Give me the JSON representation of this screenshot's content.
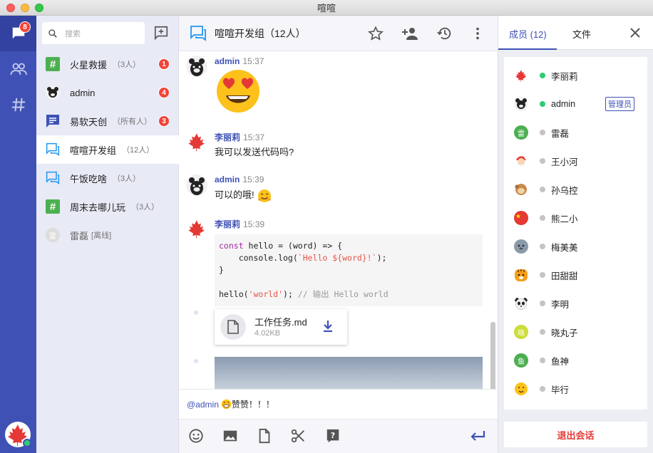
{
  "window": {
    "title": "喧喧"
  },
  "nav": {
    "chat_badge": "8"
  },
  "search": {
    "placeholder": "搜索"
  },
  "conversations": [
    {
      "name": "火星救援",
      "count": "（3人）",
      "badge": "1"
    },
    {
      "name": "admin",
      "count": "",
      "badge": "4"
    },
    {
      "name": "易软天创",
      "count": "（所有人）",
      "badge": "3"
    },
    {
      "name": "喧喧开发组",
      "count": "（12人）",
      "badge": ""
    },
    {
      "name": "午饭吃啥",
      "count": "（3人）",
      "badge": ""
    },
    {
      "name": "周末去哪儿玩",
      "count": "（3人）",
      "badge": ""
    },
    {
      "name": "雷磊",
      "count": "[离线]",
      "badge": ""
    }
  ],
  "chat": {
    "title": "喧喧开发组（12人）",
    "messages": [
      {
        "sender": "admin",
        "time": "15:37"
      },
      {
        "sender": "李丽莉",
        "time": "15:37",
        "text": "我可以发送代码吗?"
      },
      {
        "sender": "admin",
        "time": "15:39",
        "text": "可以的哦!"
      },
      {
        "sender": "李丽莉",
        "time": "15:39"
      }
    ],
    "code": {
      "l1_kw": "const",
      "l1_rest": " hello = (word) => {",
      "l2_pre": "    console.log(",
      "l2_str": "`Hello ${word}!`",
      "l2_post": ");",
      "l3": "}",
      "l5_pre": "hello(",
      "l5_str": "'world'",
      "l5_post": "); ",
      "l5_cm": "// 输出 Hello world"
    },
    "file": {
      "name": "工作任务.md",
      "size": "4.02KB"
    },
    "draft_mention": "@admin",
    "draft_text": " 赞赞！！！"
  },
  "sidebar": {
    "tab_members": "成员 (12)",
    "tab_files": "文件",
    "admin_tag": "管理员",
    "leave_label": "退出会话",
    "members": [
      {
        "name": "李丽莉",
        "online": true,
        "initial": ""
      },
      {
        "name": "admin",
        "online": true,
        "initial": ""
      },
      {
        "name": "雷磊",
        "online": false,
        "initial": "雷"
      },
      {
        "name": "王小河",
        "online": false,
        "initial": ""
      },
      {
        "name": "孙乌控",
        "online": false,
        "initial": ""
      },
      {
        "name": "熊二小",
        "online": false,
        "initial": ""
      },
      {
        "name": "梅美美",
        "online": false,
        "initial": ""
      },
      {
        "name": "田甜甜",
        "online": false,
        "initial": ""
      },
      {
        "name": "李明",
        "online": false,
        "initial": ""
      },
      {
        "name": "晓丸子",
        "online": false,
        "initial": "晓"
      },
      {
        "name": "鱼神",
        "online": false,
        "initial": "鱼"
      },
      {
        "name": "毕行",
        "online": false,
        "initial": ""
      }
    ]
  },
  "colors": {
    "primary": "#3f51b5",
    "online": "#2ecc71",
    "badge": "#f44336",
    "offline": "#c4c4c4"
  }
}
